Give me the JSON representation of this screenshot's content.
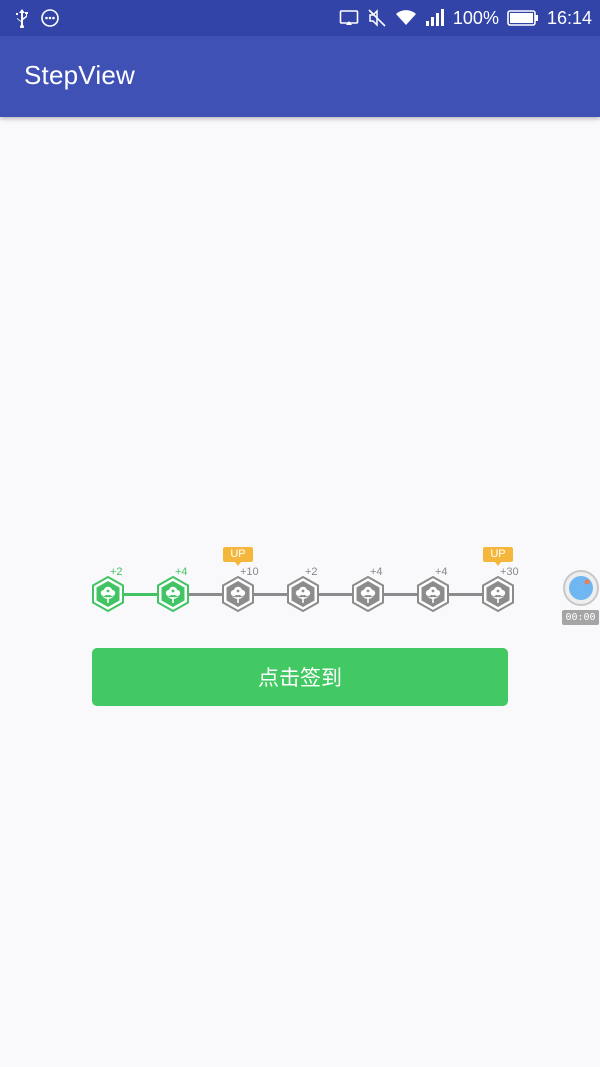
{
  "status_bar": {
    "battery": "100%",
    "time": "16:14",
    "icons": [
      "usb-icon",
      "notification-dots-icon",
      "cast-icon",
      "mute-icon",
      "wifi-icon",
      "signal-icon",
      "battery-icon"
    ]
  },
  "app_bar": {
    "title": "StepView"
  },
  "stepview": {
    "steps": [
      {
        "points": "+2",
        "completed": true,
        "up": false
      },
      {
        "points": "+4",
        "completed": true,
        "up": false
      },
      {
        "points": "+10",
        "completed": false,
        "up": true
      },
      {
        "points": "+2",
        "completed": false,
        "up": false
      },
      {
        "points": "+4",
        "completed": false,
        "up": false
      },
      {
        "points": "+4",
        "completed": false,
        "up": false
      },
      {
        "points": "+30",
        "completed": false,
        "up": true
      }
    ],
    "up_label": "UP",
    "colors": {
      "completed": "#43c464",
      "pending": "#8c8c8c",
      "badge": "#f4b73c"
    }
  },
  "signin_button": {
    "label": "点击签到",
    "color": "#42c964"
  },
  "floating_widget": {
    "timer": "00:00"
  }
}
